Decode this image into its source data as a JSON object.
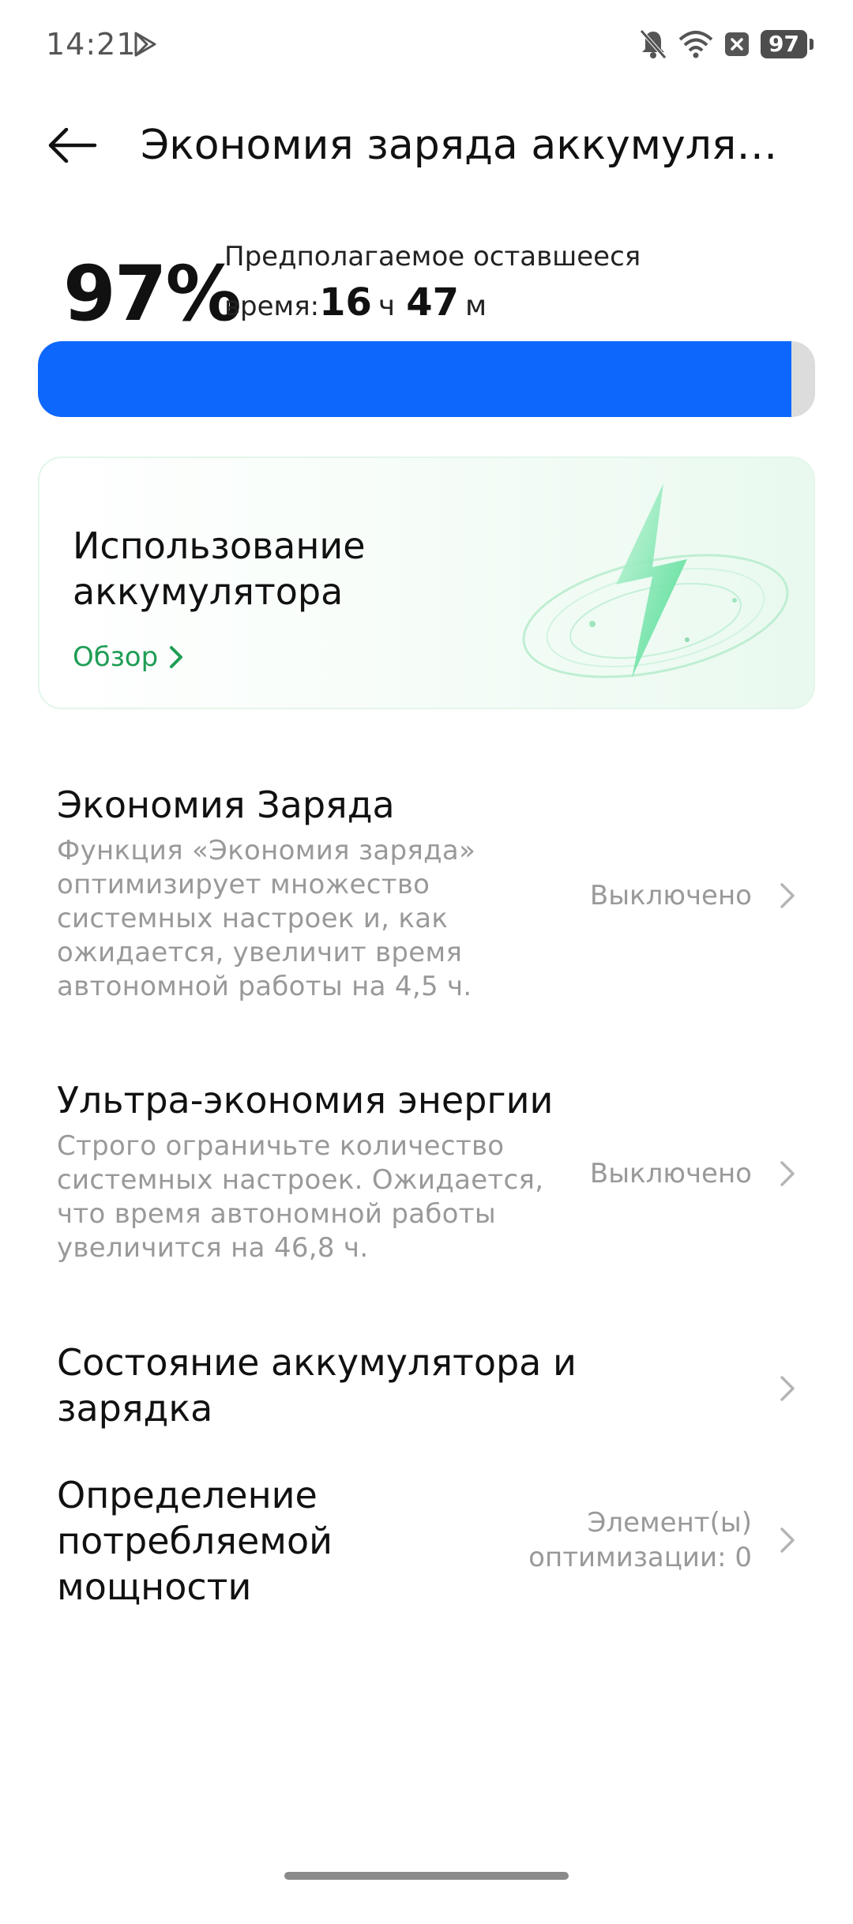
{
  "status_bar": {
    "time": "14:21",
    "battery_level": "97",
    "icons": [
      "play-store-icon",
      "bell-off-icon",
      "wifi-icon",
      "x-box-icon",
      "battery-icon"
    ]
  },
  "header": {
    "title": "Экономия заряда аккумулят…",
    "back_icon": "arrow-left-icon"
  },
  "battery": {
    "percent": "97%",
    "estimate_line1": "Предполагаемое оставшееся",
    "estimate_prefix": "время:",
    "hours": "16",
    "hours_unit": "ч",
    "minutes": "47",
    "minutes_unit": "м",
    "level_fraction": 0.97,
    "bar_color": "#0d67fd"
  },
  "usage_card": {
    "title": "Использование аккумулятора",
    "link_label": "Обзор",
    "accent_color": "#1f9d55"
  },
  "settings": [
    {
      "title": "Экономия Заряда",
      "description": "Функция «Экономия заряда» оптимизирует множество системных настроек и, как ожидается, увеличит время автономной работы на 4,5 ч.",
      "value": "Выключено"
    },
    {
      "title": "Ультра-экономия энергии",
      "description": "Строго ограничьте количество системных настроек. Ожидается, что время автономной работы увеличится на 46,8 ч.",
      "value": "Выключено"
    },
    {
      "title": "Состояние аккумулятора и зарядка",
      "description": "",
      "value": ""
    },
    {
      "title": "Определение потребляемой мощности",
      "description": "",
      "value": "Элемент(ы) оптимизации: 0"
    }
  ]
}
